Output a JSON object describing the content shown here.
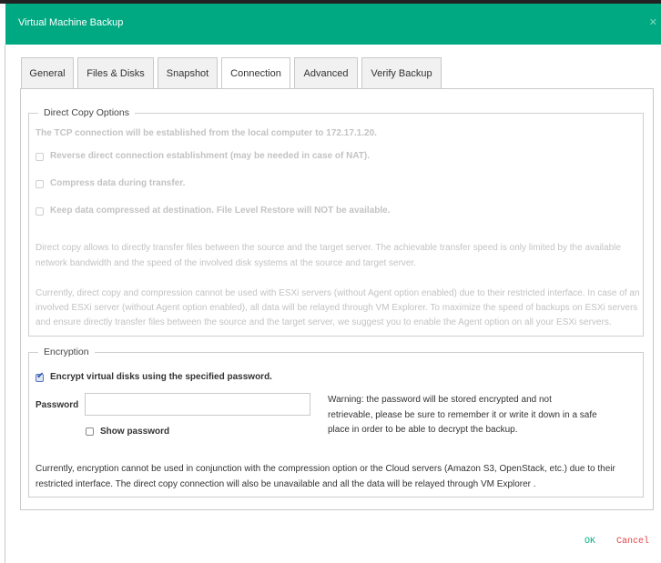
{
  "window": {
    "title": "Virtual Machine Backup",
    "close_glyph": "✕"
  },
  "tabs": [
    {
      "label": "General"
    },
    {
      "label": "Files & Disks"
    },
    {
      "label": "Snapshot"
    },
    {
      "label": "Connection"
    },
    {
      "label": "Advanced"
    },
    {
      "label": "Verify Backup"
    }
  ],
  "active_tab": "Connection",
  "direct_copy": {
    "legend": "Direct Copy Options",
    "info": "The TCP connection will be established from the local computer to 172.17.1.20.",
    "options": [
      {
        "label": "Reverse direct connection establishment (may be needed in case of NAT).",
        "checked": false,
        "enabled": false
      },
      {
        "label": "Compress data during transfer.",
        "checked": false,
        "enabled": false
      },
      {
        "label": "Keep data compressed at destination. File Level Restore will NOT be available.",
        "checked": false,
        "enabled": false
      }
    ],
    "desc1_line1": "Direct copy allows to directly transfer files between the source and the target server. The achievable transfer speed is only limited by the available",
    "desc1_line2": "network bandwidth and the speed of the involved disk systems at the source and target server.",
    "desc2_line1": "Currently, direct copy and compression cannot be used with ESXi servers (without Agent option enabled) due to their restricted interface. In case of an",
    "desc2_line2": "involved ESXi server (without Agent option enabled), all data will be relayed through VM Explorer. To maximize the speed of backups on ESXi servers",
    "desc2_line3": "and ensure directly transfer files between the source and the target server, we suggest you to enable the Agent option on all your ESXi servers."
  },
  "encryption": {
    "legend": "Encryption",
    "encrypt_label": "Encrypt virtual disks using the specified password.",
    "encrypt_checked": true,
    "password_label": "Password",
    "password_value": "",
    "show_password_label": "Show password",
    "show_password_checked": false,
    "warning_line1": "Warning: the password will be stored encrypted and not",
    "warning_line2": "retrievable, please be sure to remember it or write it down in a safe",
    "warning_line3": "place in order to be able to decrypt the backup.",
    "note_line1": "Currently, encryption cannot be used in conjunction with the compression option or the Cloud servers (Amazon S3, OpenStack, etc.) due to their",
    "note_line2": "restricted interface. The direct copy connection will also be unavailable and all the data will be relayed through VM Explorer ."
  },
  "footer": {
    "ok_label": "OK",
    "cancel_label": "Cancel"
  },
  "colors": {
    "header": "#01a982",
    "ok": "#01a982",
    "cancel": "#e04545",
    "disabled_text": "#c3c3c3"
  }
}
